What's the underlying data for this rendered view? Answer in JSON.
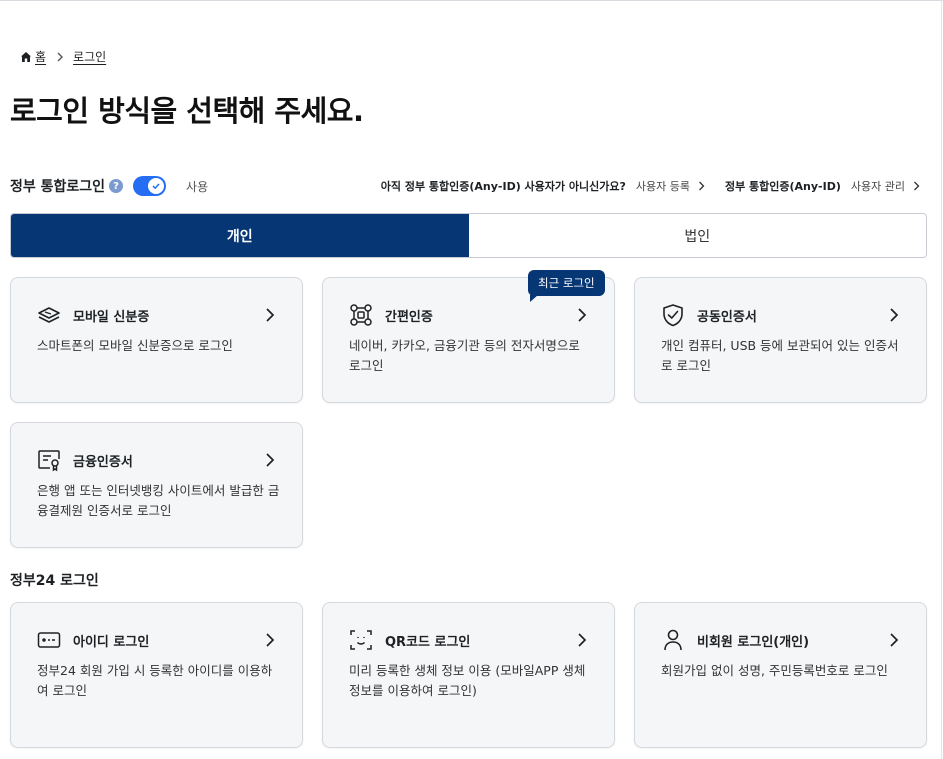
{
  "breadcrumb": {
    "home": "홈",
    "current": "로그인"
  },
  "page_title": "로그인 방식을 선택해 주세요.",
  "gov_login": {
    "label": "정부 통합로그인",
    "help": "?",
    "toggle_label": "사용",
    "toggle_on": true,
    "question": "아직 정부 통합인증(Any-ID) 사용자가 아니신가요?",
    "register_link": "사용자 등록",
    "manage_title": "정부 통합인증(Any-ID)",
    "manage_link": "사용자 관리"
  },
  "tabs": [
    {
      "label": "개인",
      "active": true
    },
    {
      "label": "법인",
      "active": false
    }
  ],
  "badge": "최근 로그인",
  "auth_cards": [
    {
      "icon": "mobile-id-icon",
      "title": "모바일 신분증",
      "desc": "스마트폰의 모바일 신분증으로 로그인"
    },
    {
      "icon": "simple-auth-icon",
      "title": "간편인증",
      "desc": "네이버, 카카오, 금융기관 등의 전자서명으로 로그인"
    },
    {
      "icon": "shield-check-icon",
      "title": "공동인증서",
      "desc": "개인 컴퓨터, USB 등에 보관되어 있는 인증서로 로그인"
    },
    {
      "icon": "certificate-icon",
      "title": "금융인증서",
      "desc": "은행 앱 또는 인터넷뱅킹 사이트에서 발급한 금융결제원 인증서로 로그인"
    }
  ],
  "section2_title": "정부24 로그인",
  "gov24_cards": [
    {
      "icon": "id-password-icon",
      "title": "아이디 로그인",
      "desc": "정부24 회원 가입 시 등록한 아이디를 이용하여 로그인"
    },
    {
      "icon": "qr-face-icon",
      "title": "QR코드 로그인",
      "desc": "미리 등록한 생체 정보 이용 (모바일APP 생체정보를 이용하여 로그인)"
    },
    {
      "icon": "person-icon",
      "title": "비회원 로그인(개인)",
      "desc": "회원가입 없이 성명, 주민등록번호로 로그인"
    }
  ],
  "colors": {
    "primary": "#063673",
    "toggle": "#256ef4",
    "card_bg": "#f5f6f7"
  }
}
